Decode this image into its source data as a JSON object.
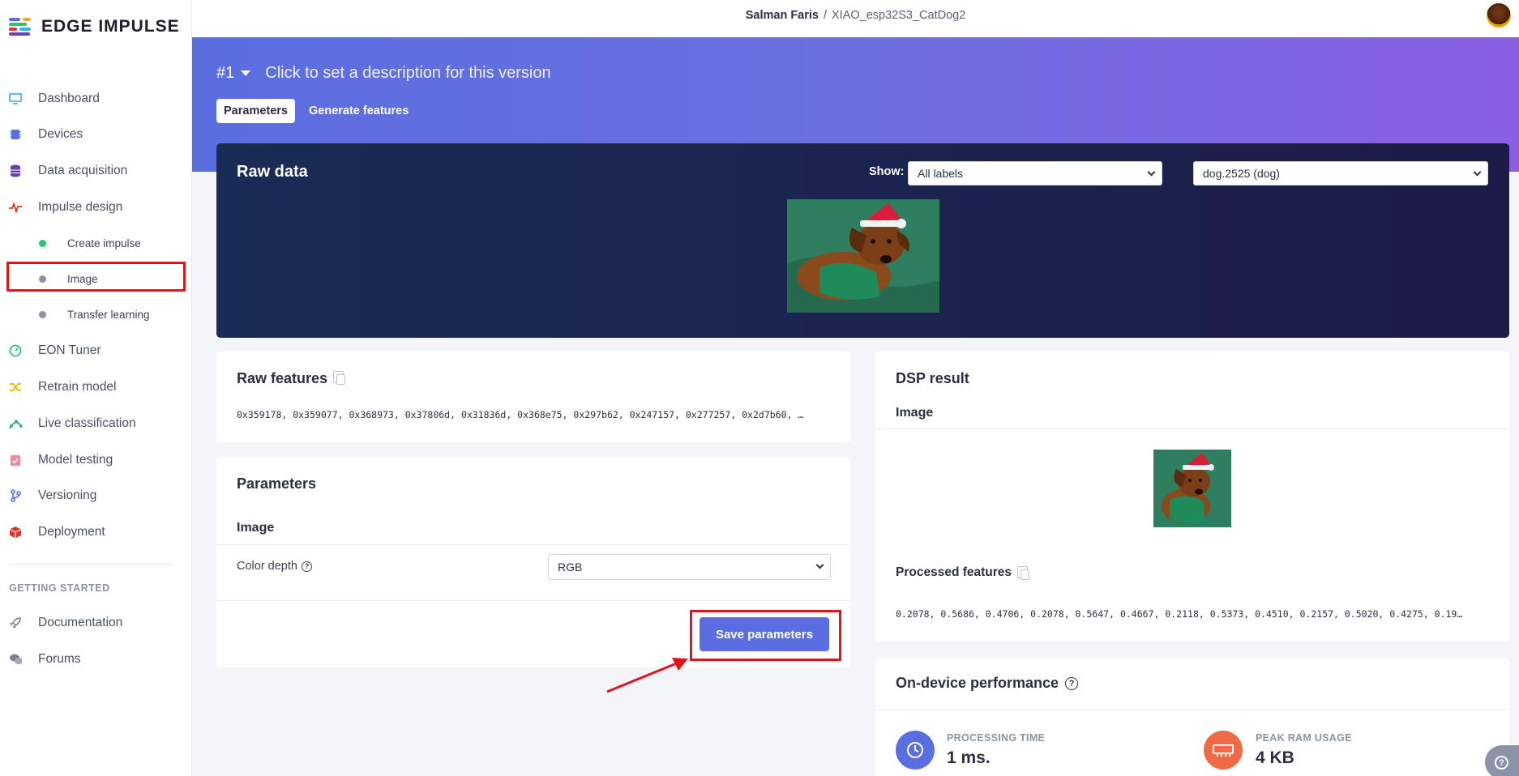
{
  "app": {
    "name": "EDGE IMPULSE"
  },
  "sidebar": {
    "items": [
      {
        "label": "Dashboard",
        "icon": "monitor-icon",
        "color": "#3ab0e0"
      },
      {
        "label": "Devices",
        "icon": "chip-icon",
        "color": "#5b6ee1"
      },
      {
        "label": "Data acquisition",
        "icon": "database-icon",
        "color": "#6a3fb5"
      },
      {
        "label": "Impulse design",
        "icon": "pulse-icon",
        "color": "#e0342a"
      },
      {
        "label": "Create impulse",
        "sub": true,
        "dot": "#28c76f"
      },
      {
        "label": "Image",
        "sub": true,
        "dot": "#8b93a5"
      },
      {
        "label": "Transfer learning",
        "sub": true,
        "dot": "#8b93a5"
      },
      {
        "label": "EON Tuner",
        "icon": "gauge-icon",
        "color": "#28c76f"
      },
      {
        "label": "Retrain model",
        "icon": "shuffle-icon",
        "color": "#f0b400"
      },
      {
        "label": "Live classification",
        "icon": "live-icon",
        "color": "#1fae7a"
      },
      {
        "label": "Model testing",
        "icon": "clipboard-check-icon",
        "color": "#f08a9a"
      },
      {
        "label": "Versioning",
        "icon": "branch-icon",
        "color": "#5b6ee1"
      },
      {
        "label": "Deployment",
        "icon": "box-icon",
        "color": "#e0342a"
      }
    ],
    "section_title": "GETTING STARTED",
    "getting_started": [
      {
        "label": "Documentation",
        "icon": "rocket-icon"
      },
      {
        "label": "Forums",
        "icon": "chat-icon"
      }
    ]
  },
  "topbar": {
    "user": "Salman Faris",
    "separator": "/",
    "project": "XIAO_esp32S3_CatDog2"
  },
  "header": {
    "version": "#1",
    "description": "Click to set a description for this version",
    "tabs": [
      "Parameters",
      "Generate features"
    ]
  },
  "raw_data": {
    "title": "Raw data",
    "show_label": "Show:",
    "label_filter": "All labels",
    "sample": "dog.2525 (dog)"
  },
  "raw_features": {
    "title": "Raw features",
    "values": "0x359178, 0x359077, 0x368973, 0x37806d, 0x31836d, 0x368e75, 0x297b62, 0x247157, 0x277257, 0x2d7b60, …"
  },
  "parameters": {
    "title": "Parameters",
    "section": "Image",
    "color_depth_label": "Color depth",
    "color_depth_value": "RGB",
    "save_label": "Save parameters"
  },
  "dsp": {
    "title": "DSP result",
    "image_label": "Image",
    "processed_title": "Processed features",
    "processed_values": "0.2078, 0.5686, 0.4706, 0.2078, 0.5647, 0.4667, 0.2118, 0.5373, 0.4510, 0.2157, 0.5020, 0.4275, 0.19…"
  },
  "performance": {
    "title": "On-device performance",
    "processing_label": "PROCESSING TIME",
    "processing_value": "1 ms.",
    "ram_label": "PEAK RAM USAGE",
    "ram_value": "4 KB"
  }
}
